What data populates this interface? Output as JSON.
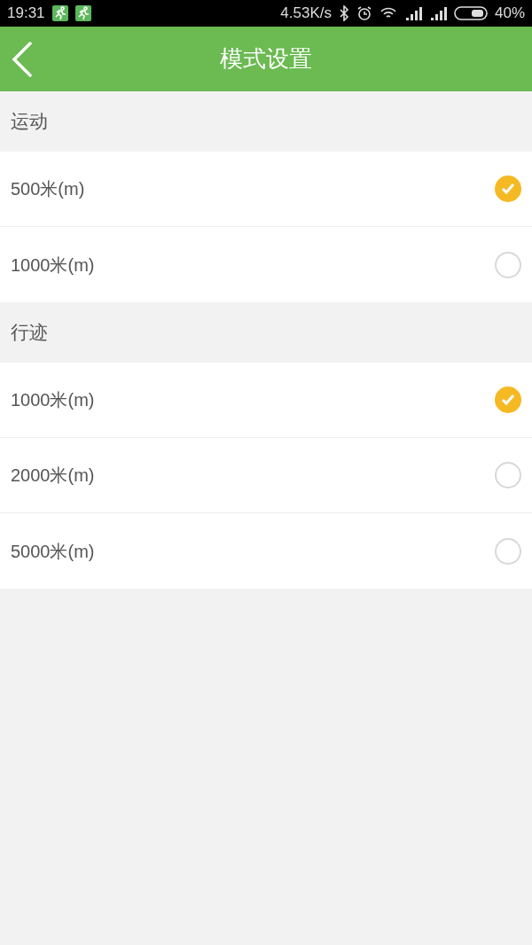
{
  "status_bar": {
    "time": "19:31",
    "speed": "4.53K/s",
    "battery": "40%"
  },
  "header": {
    "title": "模式设置"
  },
  "sections": [
    {
      "title": "运动",
      "options": [
        {
          "label": "500米(m)",
          "selected": true
        },
        {
          "label": "1000米(m)",
          "selected": false
        }
      ]
    },
    {
      "title": "行迹",
      "options": [
        {
          "label": "1000米(m)",
          "selected": true
        },
        {
          "label": "2000米(m)",
          "selected": false
        },
        {
          "label": "5000米(m)",
          "selected": false
        }
      ]
    }
  ]
}
